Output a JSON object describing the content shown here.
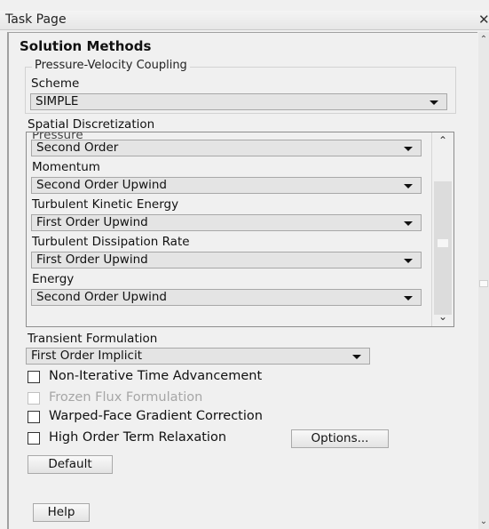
{
  "window": {
    "title": "Task Page"
  },
  "heading": "Solution Methods",
  "pressure_velocity": {
    "legend": "Pressure-Velocity Coupling",
    "scheme_label": "Scheme",
    "scheme_value": "SIMPLE"
  },
  "spatial": {
    "legend": "Spatial Discretization",
    "clipped_label": "Pressure",
    "items": [
      {
        "label": "Pressure",
        "value": "Second Order"
      },
      {
        "label": "Momentum",
        "value": "Second Order Upwind"
      },
      {
        "label": "Turbulent Kinetic Energy",
        "value": "First Order Upwind"
      },
      {
        "label": "Turbulent Dissipation Rate",
        "value": "First Order Upwind"
      },
      {
        "label": "Energy",
        "value": "Second Order Upwind"
      }
    ]
  },
  "transient": {
    "label": "Transient Formulation",
    "value": "First Order Implicit"
  },
  "options": {
    "non_iterative": "Non-Iterative Time Advancement",
    "frozen_flux": "Frozen Flux Formulation",
    "warped_face": "Warped-Face Gradient Correction",
    "high_order": "High Order Term Relaxation",
    "options_button": "Options..."
  },
  "buttons": {
    "default": "Default",
    "help": "Help"
  },
  "icons": {
    "close": "close-icon",
    "dropdown": "chevron-down-icon",
    "scroll_up": "scroll-up-icon",
    "scroll_down": "scroll-down-icon"
  }
}
